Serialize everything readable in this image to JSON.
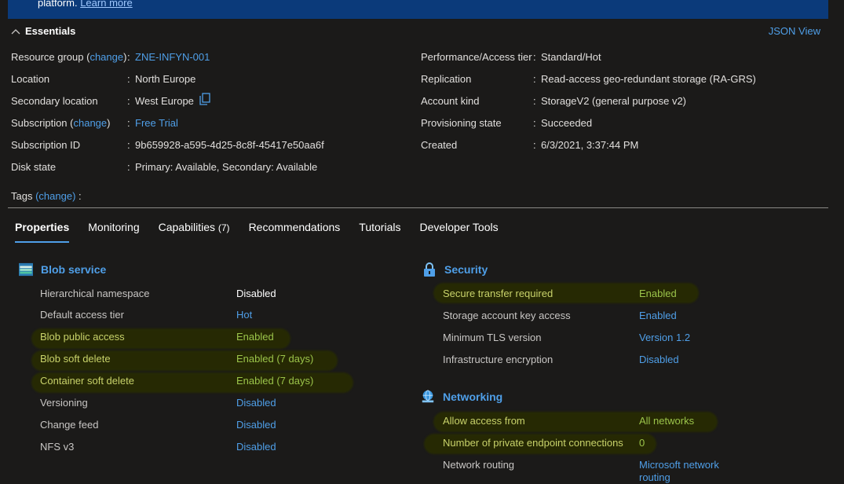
{
  "banner": {
    "text": "platform.",
    "link": "Learn more"
  },
  "essentials": {
    "title": "Essentials",
    "json_view": "JSON View"
  },
  "left": [
    {
      "label_pre": "Resource group (",
      "label_link": "change",
      "label_post": ")",
      "value": "ZNE-INFYN-001",
      "value_link": true
    },
    {
      "label_pre": "Location",
      "value": "North Europe"
    },
    {
      "label_pre": "Secondary location",
      "value": "West Europe",
      "copy_icon": "copy-icon"
    },
    {
      "label_pre": "Subscription (",
      "label_link": "change",
      "label_post": ")",
      "value": "Free Trial",
      "value_link": true
    },
    {
      "label_pre": "Subscription ID",
      "value": "9b659928-a595-4d25-8c8f-45417e50aa6f"
    },
    {
      "label_pre": "Disk state",
      "value": "Primary: Available, Secondary: Available"
    }
  ],
  "right": [
    {
      "label": "Performance/Access tier",
      "value": "Standard/Hot"
    },
    {
      "label": "Replication",
      "value": "Read-access geo-redundant storage (RA-GRS)"
    },
    {
      "label": "Account kind",
      "value": "StorageV2 (general purpose v2)"
    },
    {
      "label": "Provisioning state",
      "value": "Succeeded"
    },
    {
      "label": "Created",
      "value": "6/3/2021, 3:37:44 PM"
    }
  ],
  "tags": {
    "label": "Tags",
    "link": "(change)",
    "colon": ":"
  },
  "colon": ":",
  "tabs": [
    "Properties",
    "Monitoring",
    "Capabilities",
    "(7)",
    "Recommendations",
    "Tutorials",
    "Developer Tools"
  ],
  "blob": {
    "title": "Blob service",
    "rows": [
      {
        "label": "Hierarchical namespace",
        "value": "Disabled"
      },
      {
        "label": "Default access tier",
        "value": "Hot"
      },
      {
        "label": "Blob public access",
        "value": "Enabled"
      },
      {
        "label": "Blob soft delete",
        "value": "Enabled (7 days)"
      },
      {
        "label": "Container soft delete",
        "value": "Enabled (7 days)"
      },
      {
        "label": "Versioning",
        "value": "Disabled"
      },
      {
        "label": "Change feed",
        "value": "Disabled"
      },
      {
        "label": "NFS v3",
        "value": "Disabled"
      }
    ]
  },
  "security": {
    "title": "Security",
    "rows": [
      {
        "label": "Secure transfer required",
        "value": "Enabled"
      },
      {
        "label": "Storage account key access",
        "value": "Enabled"
      },
      {
        "label": "Minimum TLS version",
        "value": "Version 1.2"
      },
      {
        "label": "Infrastructure encryption",
        "value": "Disabled"
      }
    ]
  },
  "networking": {
    "title": "Networking",
    "rows": [
      {
        "label": "Allow access from",
        "value": "All networks"
      },
      {
        "label": "Number of private endpoint connections",
        "value": "0"
      },
      {
        "label": "Network routing",
        "value": "Microsoft network",
        "value2": "routing"
      }
    ]
  }
}
